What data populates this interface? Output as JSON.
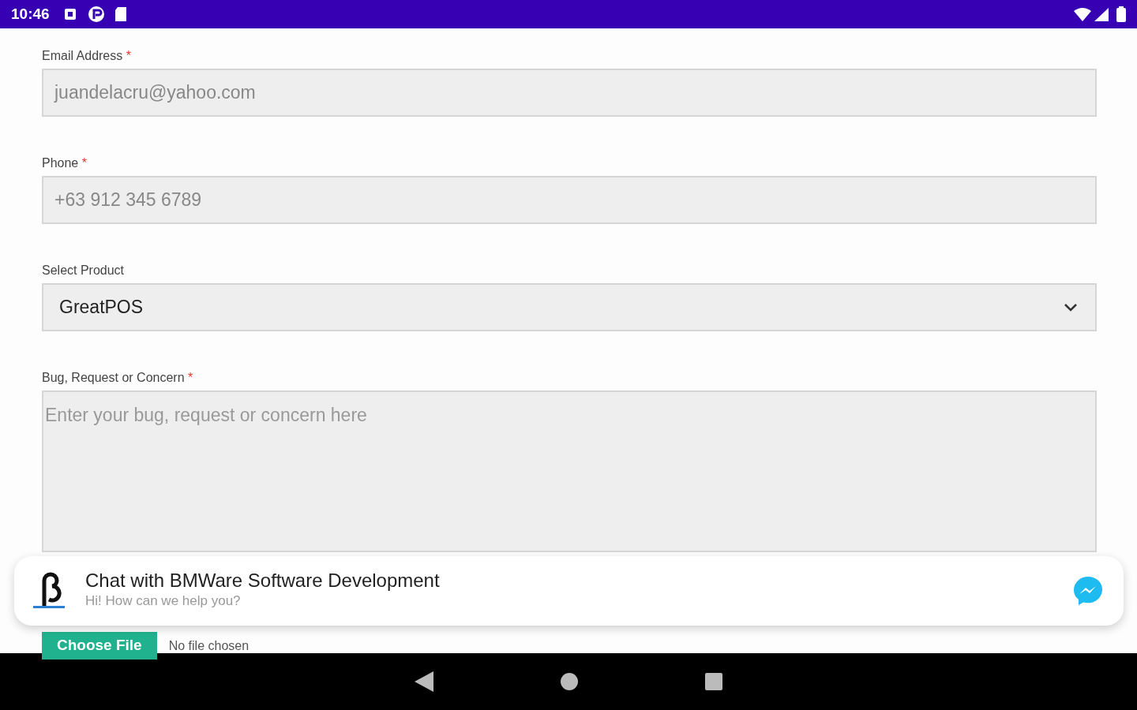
{
  "status_bar": {
    "time": "10:46"
  },
  "fields": [
    {
      "kind": "input",
      "label": "Email Address",
      "required_marker": "*",
      "value": "juandelacru@yahoo.com",
      "disabled": true
    },
    {
      "kind": "input",
      "label": "Phone",
      "required_marker": "*",
      "value": "+63 912 345 6789",
      "disabled": true
    },
    {
      "kind": "select",
      "label": "Select Product",
      "value": "GreatPOS",
      "disabled": false
    },
    {
      "kind": "textarea",
      "label": "Bug, Request or Concern",
      "required_marker": "*",
      "placeholder": "Enter your bug, request or concern here"
    }
  ],
  "file_input": {
    "button": "Choose File",
    "status": "No file chosen"
  },
  "chat_banner": {
    "title": "Chat with BMWare Software Development",
    "subtitle": "Hi! How can we help you?"
  }
}
